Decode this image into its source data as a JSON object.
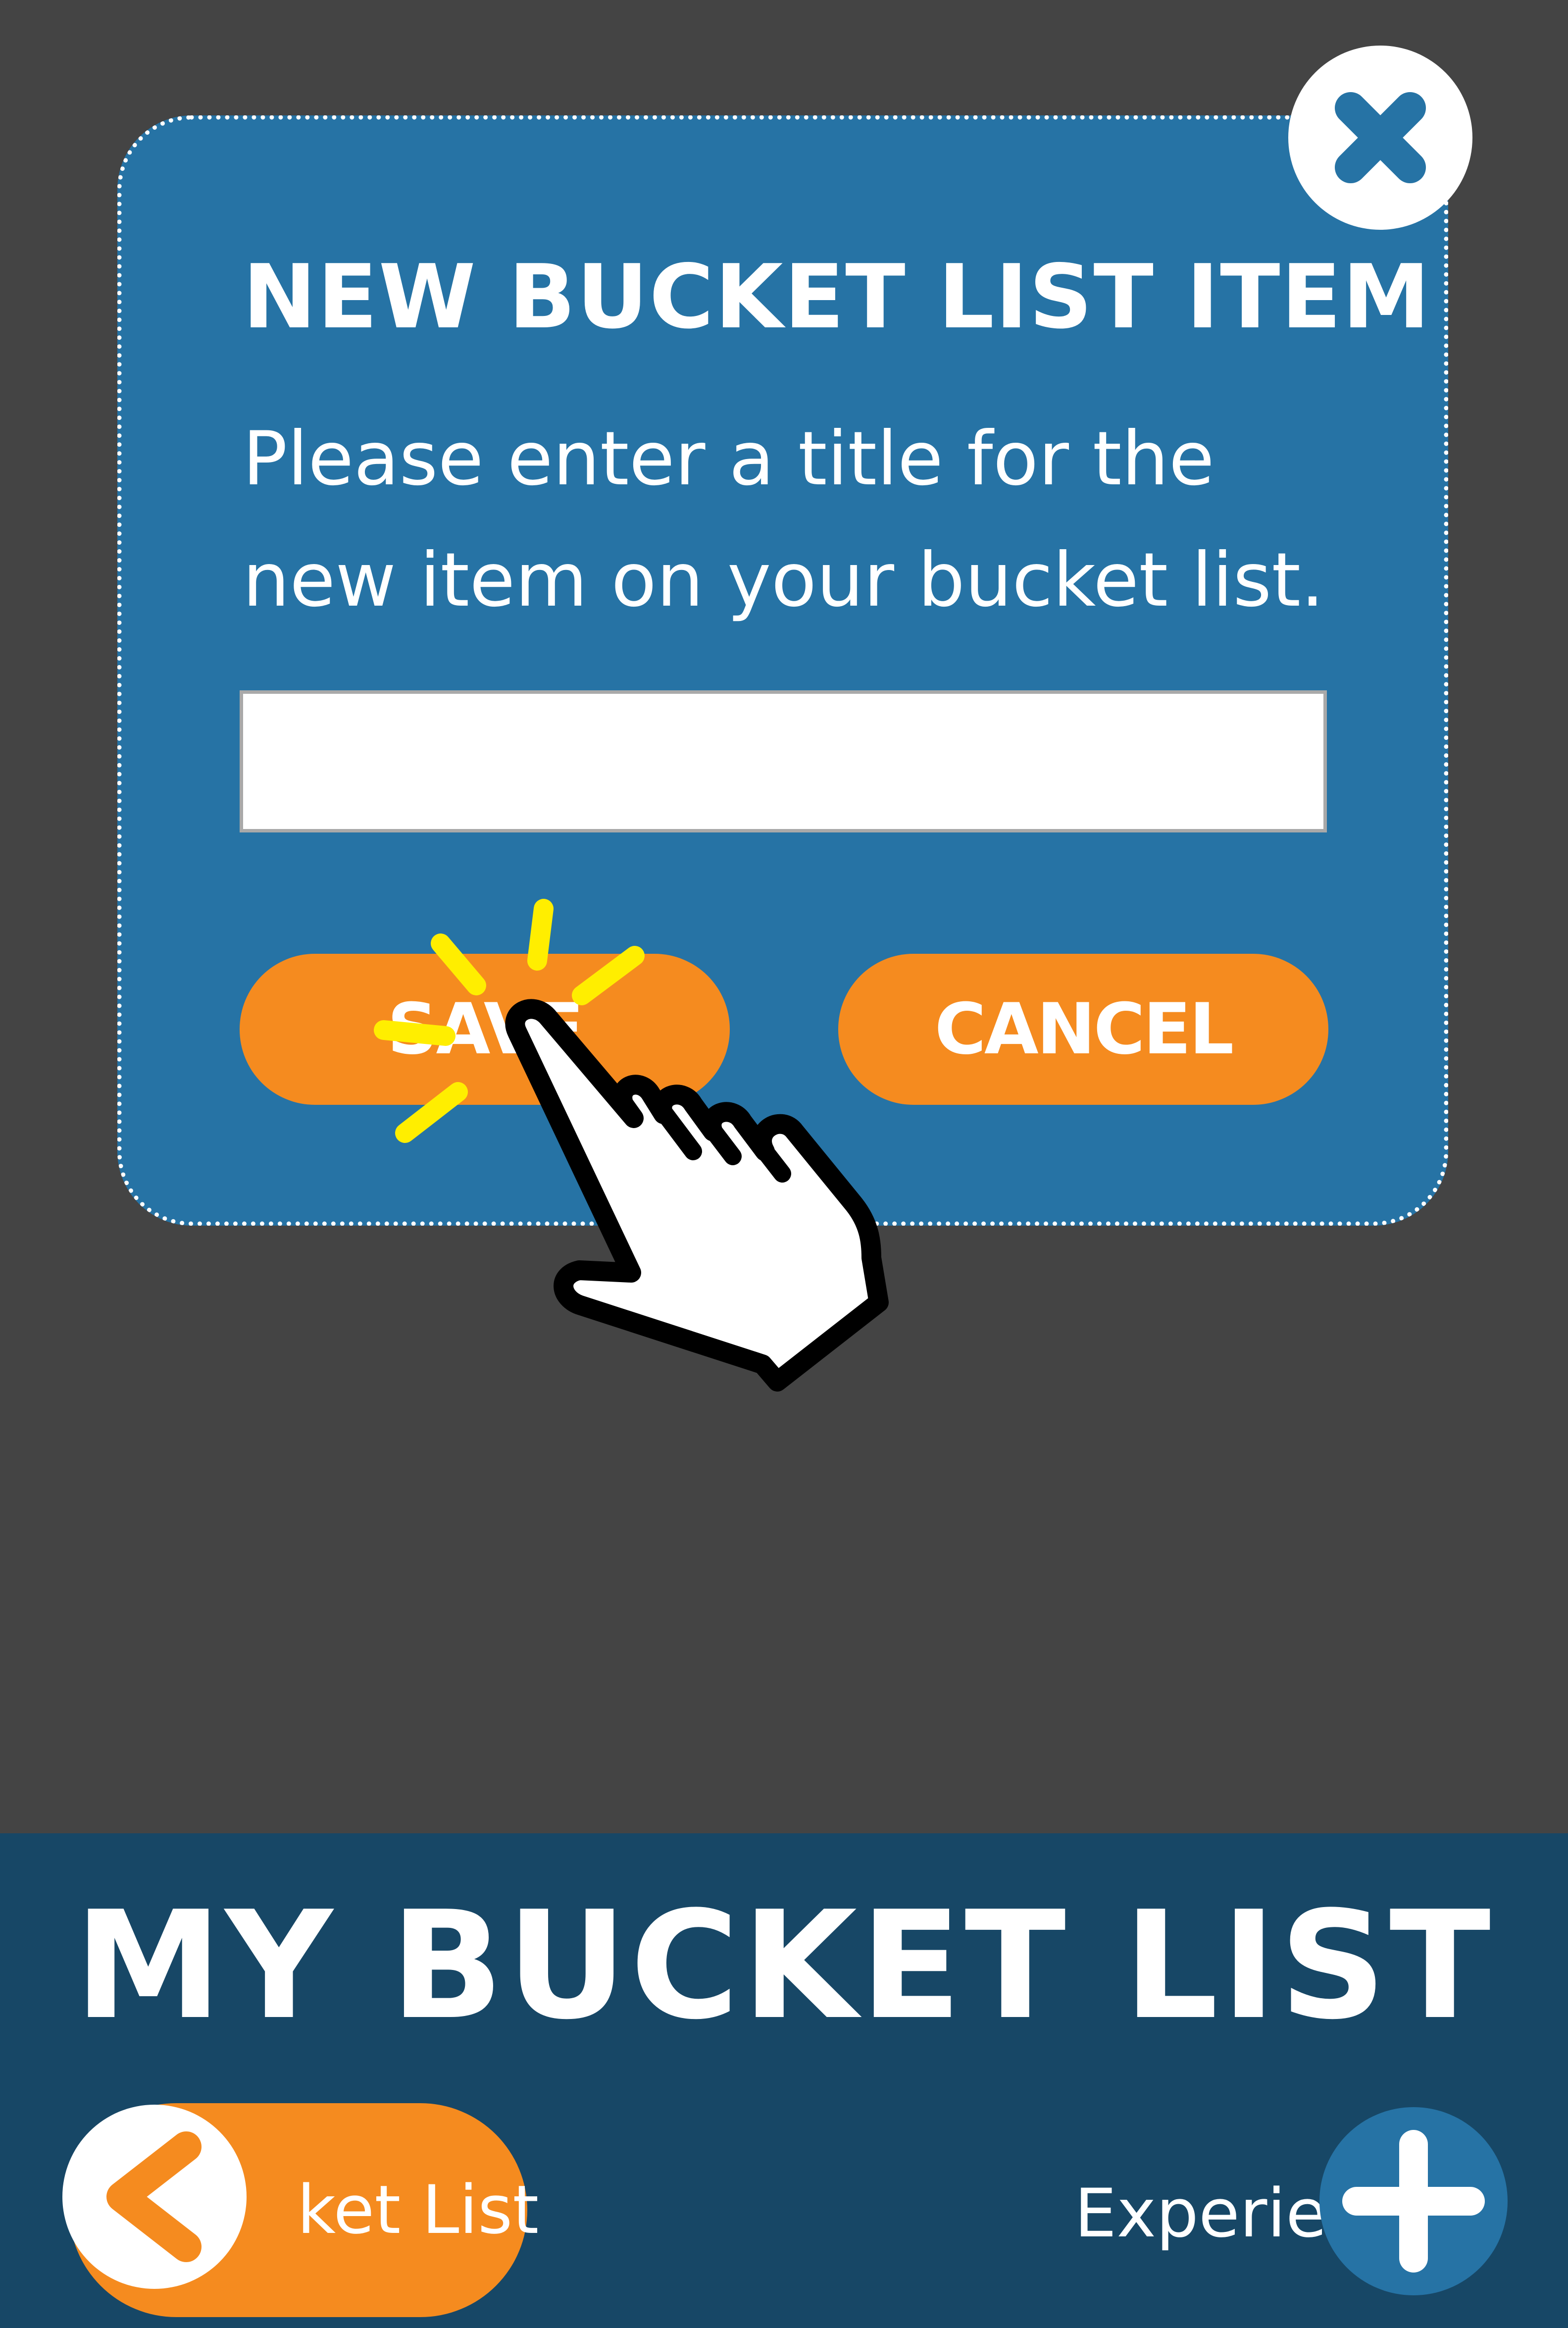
{
  "dialog": {
    "title": "NEW BUCKET LIST ITEM",
    "message": "Please enter a title for the new item on your bucket list.",
    "input": {
      "value": "",
      "placeholder": ""
    },
    "save_label": "SAVE",
    "cancel_label": "CANCEL",
    "close_icon": "close-x-icon"
  },
  "header": {
    "title": "MY BUCKET LIST",
    "back_label": "ket List",
    "back_icon": "chevron-left-icon",
    "experience_label": "Experien",
    "add_icon": "plus-icon"
  },
  "overlay": {
    "gesture_icon": "tap-hand-icon"
  },
  "colors": {
    "background": "#444444",
    "dialog_blue": "#2673a5",
    "header_navy": "#174766",
    "accent_orange": "#f58b1f",
    "tap_spark_yellow": "#ffee00"
  }
}
